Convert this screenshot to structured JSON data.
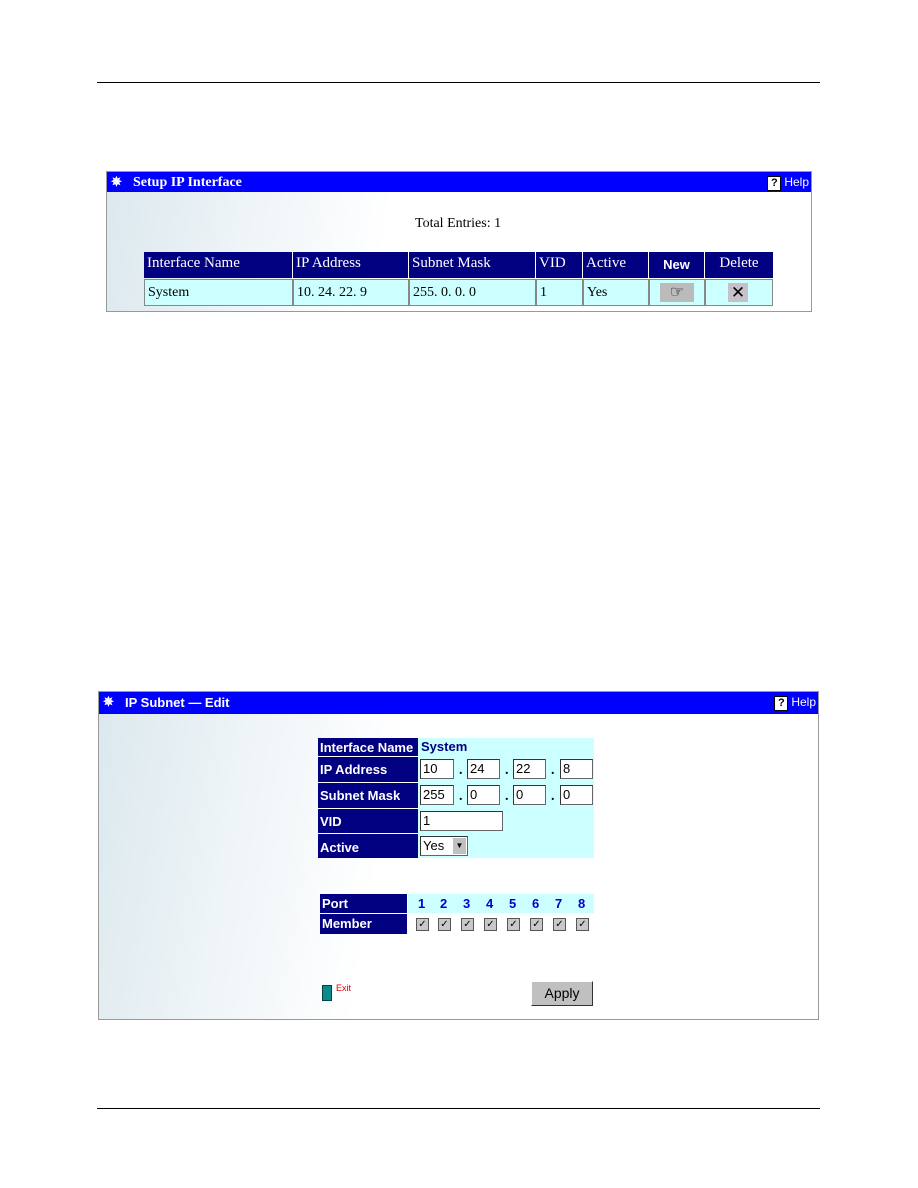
{
  "setup_panel": {
    "title": "Setup IP Interface",
    "help": "Help",
    "total_entries": "Total Entries: 1",
    "columns": [
      "Interface Name",
      "IP Address",
      "Subnet Mask",
      "VID",
      "Active",
      "New",
      "Delete"
    ],
    "rows": [
      {
        "interface_name": "System",
        "ip_address": "10. 24. 22. 9",
        "subnet_mask": "255. 0. 0. 0",
        "vid": "1",
        "active": "Yes"
      }
    ]
  },
  "edit_panel": {
    "title": "IP Subnet — Edit",
    "help": "Help",
    "labels": {
      "interface_name": "Interface Name",
      "ip_address": "IP Address",
      "subnet_mask": "Subnet Mask",
      "vid": "VID",
      "active": "Active",
      "port": "Port",
      "member": "Member"
    },
    "interface_name": "System",
    "ip": [
      "10",
      "24",
      "22",
      "8"
    ],
    "mask": [
      "255",
      "0",
      "0",
      "0"
    ],
    "vid": "1",
    "active": "Yes",
    "ports": [
      "1",
      "2",
      "3",
      "4",
      "5",
      "6",
      "7",
      "8"
    ],
    "members_checked": [
      true,
      true,
      true,
      true,
      true,
      true,
      true,
      true
    ],
    "exit": "Exit",
    "apply": "Apply"
  },
  "colors": {
    "titlebar": "#0000ff",
    "header": "#000080",
    "cell": "#ccffff"
  }
}
